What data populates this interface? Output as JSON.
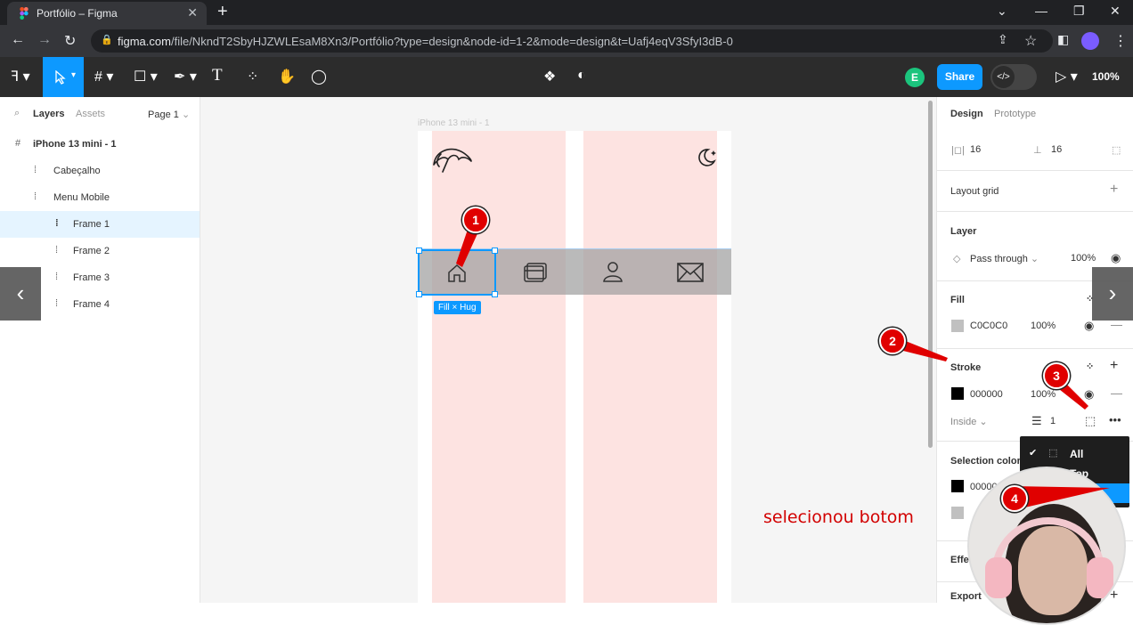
{
  "browser": {
    "tab_title": "Portfólio – Figma",
    "url_host": "figma.com",
    "url_path": "/file/NkndT2SbyHJZWLEsaM8Xn3/Portfólio?type=design&node-id=1-2&mode=design&t=Uafj4eqV3SfyI3dB-0"
  },
  "toolbar": {
    "share_label": "Share",
    "user_initial": "E",
    "zoom": "100%"
  },
  "layers_panel": {
    "tab_layers": "Layers",
    "tab_assets": "Assets",
    "page": "Page 1",
    "items": [
      {
        "label": "iPhone 13 mini - 1"
      },
      {
        "label": "Cabeçalho"
      },
      {
        "label": "Menu Mobile"
      },
      {
        "label": "Frame 1"
      },
      {
        "label": "Frame 2"
      },
      {
        "label": "Frame 3"
      },
      {
        "label": "Frame 4"
      }
    ]
  },
  "canvas": {
    "frame_label": "iPhone 13 mini - 1",
    "size_badge": "Fill × Hug",
    "annotation_text": "selecionou botom"
  },
  "design_panel": {
    "tab_design": "Design",
    "tab_prototype": "Prototype",
    "padding_h": "16",
    "padding_v": "16",
    "layout_grid": "Layout grid",
    "layer_title": "Layer",
    "blend_mode": "Pass through",
    "layer_opacity": "100%",
    "fill_title": "Fill",
    "fill_hex": "C0C0C0",
    "fill_opacity": "100%",
    "stroke_title": "Stroke",
    "stroke_hex": "000000",
    "stroke_opacity": "100%",
    "stroke_position": "Inside",
    "stroke_weight": "1",
    "selection_colors_title": "Selection colors",
    "sel_color_1": "000000",
    "effects_title": "Effe",
    "export_title": "Export"
  },
  "stroke_sides_menu": {
    "options": [
      "All",
      "Top"
    ]
  },
  "markers": [
    "1",
    "2",
    "3",
    "4"
  ],
  "colors": {
    "accent_blue": "#0d99ff",
    "marker_red": "#e00000",
    "fill_swatch": "#c0c0c0",
    "stroke_swatch": "#000000",
    "column_pink": "#fde3e1",
    "annotation_red": "#d20000"
  }
}
